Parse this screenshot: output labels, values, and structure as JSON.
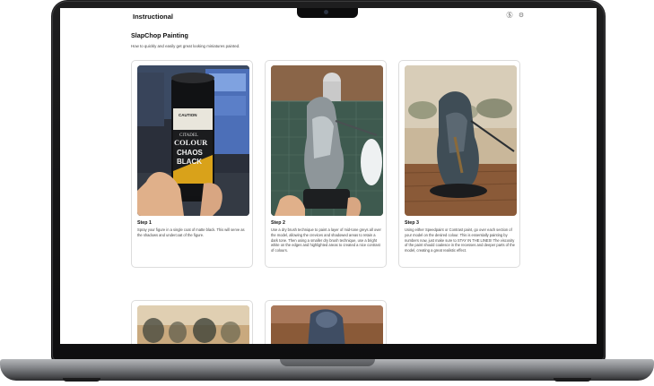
{
  "app": {
    "title": "Instructional"
  },
  "header_icons": [
    {
      "name": "account-icon",
      "glyph": "Ⓢ"
    },
    {
      "name": "settings-icon",
      "glyph": "⚙"
    }
  ],
  "page": {
    "title": "SlapChop Painting",
    "subtitle": "How to quickly and easily get great looking miniatures painted."
  },
  "steps": [
    {
      "title": "Step 1",
      "text": "Spray your figure in a single coat of matte black. This will serve as the shadows and undercoat of the figure.",
      "image": "spray-can-photo",
      "image_text": {
        "warning": "CAUTION",
        "brand": "CITADEL",
        "line1": "COLOUR",
        "line2": "CHAOS",
        "line3": "BLACK"
      }
    },
    {
      "title": "Step 2",
      "text": "Use a dry brush technique to paint a layer of mid-tone greys all over the model, allowing the crevices and shadowed areas to retain a dark tone. Then using a smaller dry brush technique, use a bright white on the edges and highlighted areas to created a nice contrast of colours.",
      "image": "drybrushed-miniature-photo"
    },
    {
      "title": "Step 3",
      "text": "Using either Speedpaint or Contrast paint, go over each section of your model on the desired colour. This is essentially painting by numbers now, just make sure to STAY IN THE LINES! The viscosity of the paint should coalesce in the recesses and deeper parts of the model, creating a great realistic effect.",
      "image": "painted-miniature-photo"
    },
    {
      "image": "miniature-group-photo"
    },
    {
      "image": "miniature-closeup-photo"
    }
  ],
  "colors": {
    "frame": "#111112",
    "card_border": "#dcdcdc",
    "text": "#111111",
    "muted_text": "#444444"
  }
}
